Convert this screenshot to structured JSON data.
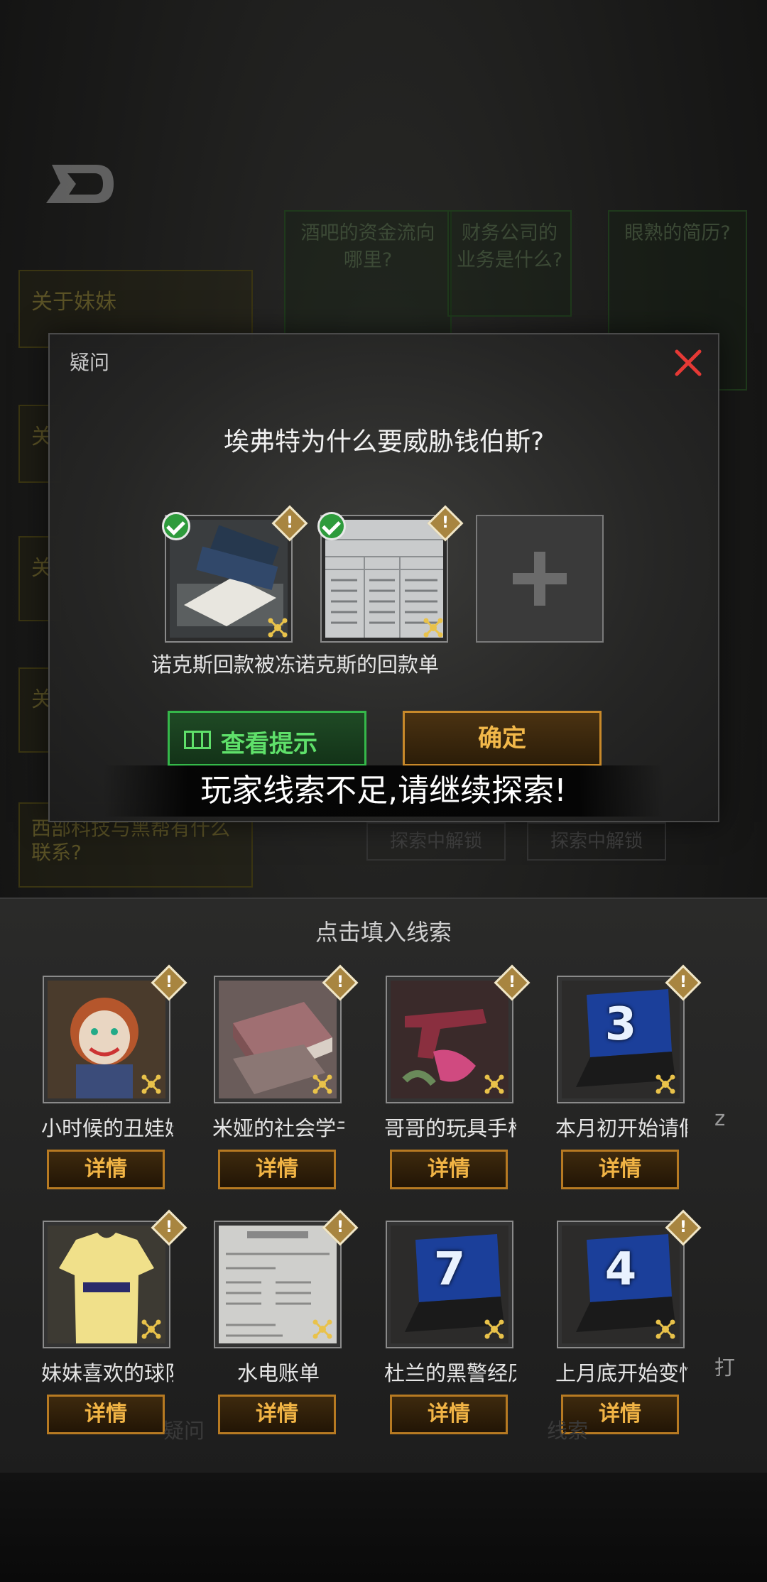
{
  "background": {
    "side_items": [
      "关于妹妹",
      "关",
      "关",
      "关",
      "西部科技与黑帮有什么联系?"
    ],
    "questions": [
      "酒吧的资金流向哪里?",
      "财务公司的业务是什么?",
      "眼熟的简历?"
    ],
    "locked_buttons": [
      "探索中解锁",
      "探索中解锁"
    ],
    "bottom_tabs": [
      "疑问",
      "线索"
    ]
  },
  "dialog": {
    "title": "疑问",
    "question": "埃弗特为什么要威胁钱伯斯?",
    "slots": [
      {
        "caption": "诺克斯回款被冻",
        "checked": true
      },
      {
        "caption": "诺克斯的回款单",
        "checked": true
      }
    ],
    "hint_button": "查看提示",
    "confirm_button": "确定",
    "toast": "玩家线索不足,请继续探索!"
  },
  "panel": {
    "title": "点击填入线索",
    "detail_label": "详情",
    "cards_row1": [
      {
        "name": "小时候的丑娃娃",
        "badge": ""
      },
      {
        "name": "米娅的社会学书",
        "badge": ""
      },
      {
        "name": "哥哥的玩具手枪",
        "badge": ""
      },
      {
        "name": "本月初开始请假",
        "badge": "3"
      }
    ],
    "cards_row2": [
      {
        "name": "妹妹喜欢的球队",
        "badge": ""
      },
      {
        "name": "水电账单",
        "badge": ""
      },
      {
        "name": "杜兰的黑警经历",
        "badge": "7"
      },
      {
        "name": "上月底开始变忙",
        "badge": "4"
      }
    ],
    "peek_row1": "z",
    "peek_row2": "打"
  },
  "colors": {
    "hint_green": "#35b84a",
    "confirm_orange": "#c8892a",
    "close_red": "#e53935",
    "check_green": "#2e9b3c"
  }
}
